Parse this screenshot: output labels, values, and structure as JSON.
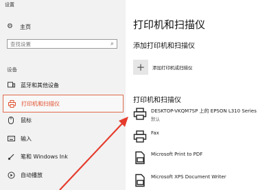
{
  "window": {
    "title": "设置"
  },
  "sidebar": {
    "home_label": "主页",
    "search_placeholder": "查找设置",
    "section_label": "设备",
    "items": [
      {
        "label": "蓝牙和其他设备",
        "icon": "bluetooth-devices-icon"
      },
      {
        "label": "打印机和扫描仪",
        "icon": "printer-icon",
        "selected": true
      },
      {
        "label": "鼠标",
        "icon": "mouse-icon"
      },
      {
        "label": "输入",
        "icon": "keyboard-icon"
      },
      {
        "label": "笔和 Windows Ink",
        "icon": "pen-icon"
      },
      {
        "label": "自动播放",
        "icon": "autoplay-icon"
      }
    ]
  },
  "main": {
    "title": "打印机和扫描仪",
    "add_heading": "添加打印机和扫描仪",
    "add_button_label": "添加打印机或扫描仪",
    "list_heading": "打印机和扫描仪",
    "devices": [
      {
        "name": "DESKTOP-VKQM7SP 上的 EPSON L310 Series",
        "status": "默认",
        "icon": "printer-icon"
      },
      {
        "name": "Fax",
        "status": "",
        "icon": "fax-icon"
      },
      {
        "name": "Microsoft Print to PDF",
        "status": "",
        "icon": "pdf-printer-icon"
      },
      {
        "name": "Microsoft XPS Document Writer",
        "status": "",
        "icon": "xps-printer-icon"
      }
    ]
  },
  "colors": {
    "accent": "#e0502e",
    "sidebar_bg": "#f2f2f2",
    "annotation_arrow": "#e53b2c"
  }
}
